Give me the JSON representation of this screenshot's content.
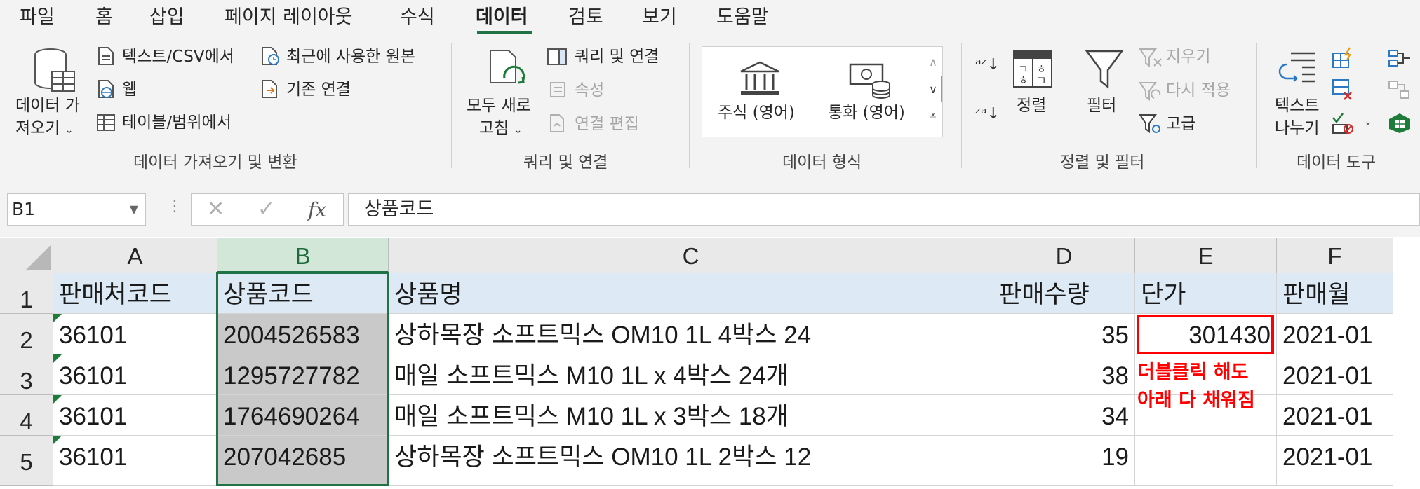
{
  "tabs": [
    "파일",
    "홈",
    "삽입",
    "페이지 레이아웃",
    "수식",
    "데이터",
    "검토",
    "보기",
    "도움말"
  ],
  "active_tab": "데이터",
  "ribbon": {
    "get_data_line1": "데이터 가",
    "get_data_line2": "져오기",
    "from_text_csv": "텍스트/CSV에서",
    "from_web": "웹",
    "from_table": "테이블/범위에서",
    "recent_sources": "최근에 사용한 원본",
    "existing_connections": "기존 연결",
    "group_get_transform": "데이터 가져오기 및 변환",
    "refresh_all_line1": "모두 새로",
    "refresh_all_line2": "고침",
    "queries_connections": "쿼리 및 연결",
    "properties": "속성",
    "edit_links": "연결 편집",
    "group_queries": "쿼리 및 연결",
    "stocks": "주식 (영어)",
    "currencies": "통화 (영어)",
    "group_data_types": "데이터 형식",
    "sort": "정렬",
    "filter": "필터",
    "clear": "지우기",
    "reapply": "다시 적용",
    "advanced": "고급",
    "group_sort_filter": "정렬 및 필터",
    "text_to_columns_line1": "텍스트",
    "text_to_columns_line2": "나누기",
    "group_data_tools": "데이터 도구"
  },
  "formula_bar": {
    "name_box": "B1",
    "fx": "fx",
    "content": "상품코드"
  },
  "columns": [
    "A",
    "B",
    "C",
    "D",
    "E",
    "F"
  ],
  "rows": [
    "1",
    "2",
    "3",
    "4",
    "5"
  ],
  "table": {
    "headers": [
      "판매처코드",
      "상품코드",
      "상품명",
      "판매수량",
      "단가",
      "판매월"
    ],
    "data": [
      [
        "36101",
        "2004526583",
        "상하목장 소프트믹스 OM10 1L 4박스 24",
        "35",
        "301430",
        "2021-01"
      ],
      [
        "36101",
        "1295727782",
        "매일 소프트믹스 M10 1L x 4박스 24개",
        "38",
        "",
        "2021-01"
      ],
      [
        "36101",
        "1764690264",
        "매일 소프트믹스 M10 1L x 3박스 18개",
        "34",
        "",
        "2021-01"
      ],
      [
        "36101",
        "207042685",
        "상하목장 소프트믹스 OM10 1L 2박스 12",
        "19",
        "",
        "2021-01"
      ]
    ]
  },
  "annotation": {
    "line1": "더블클릭 해도",
    "line2": "아래 다 채워짐"
  },
  "colors": {
    "accent": "#217346",
    "annotation": "#ff0000"
  }
}
